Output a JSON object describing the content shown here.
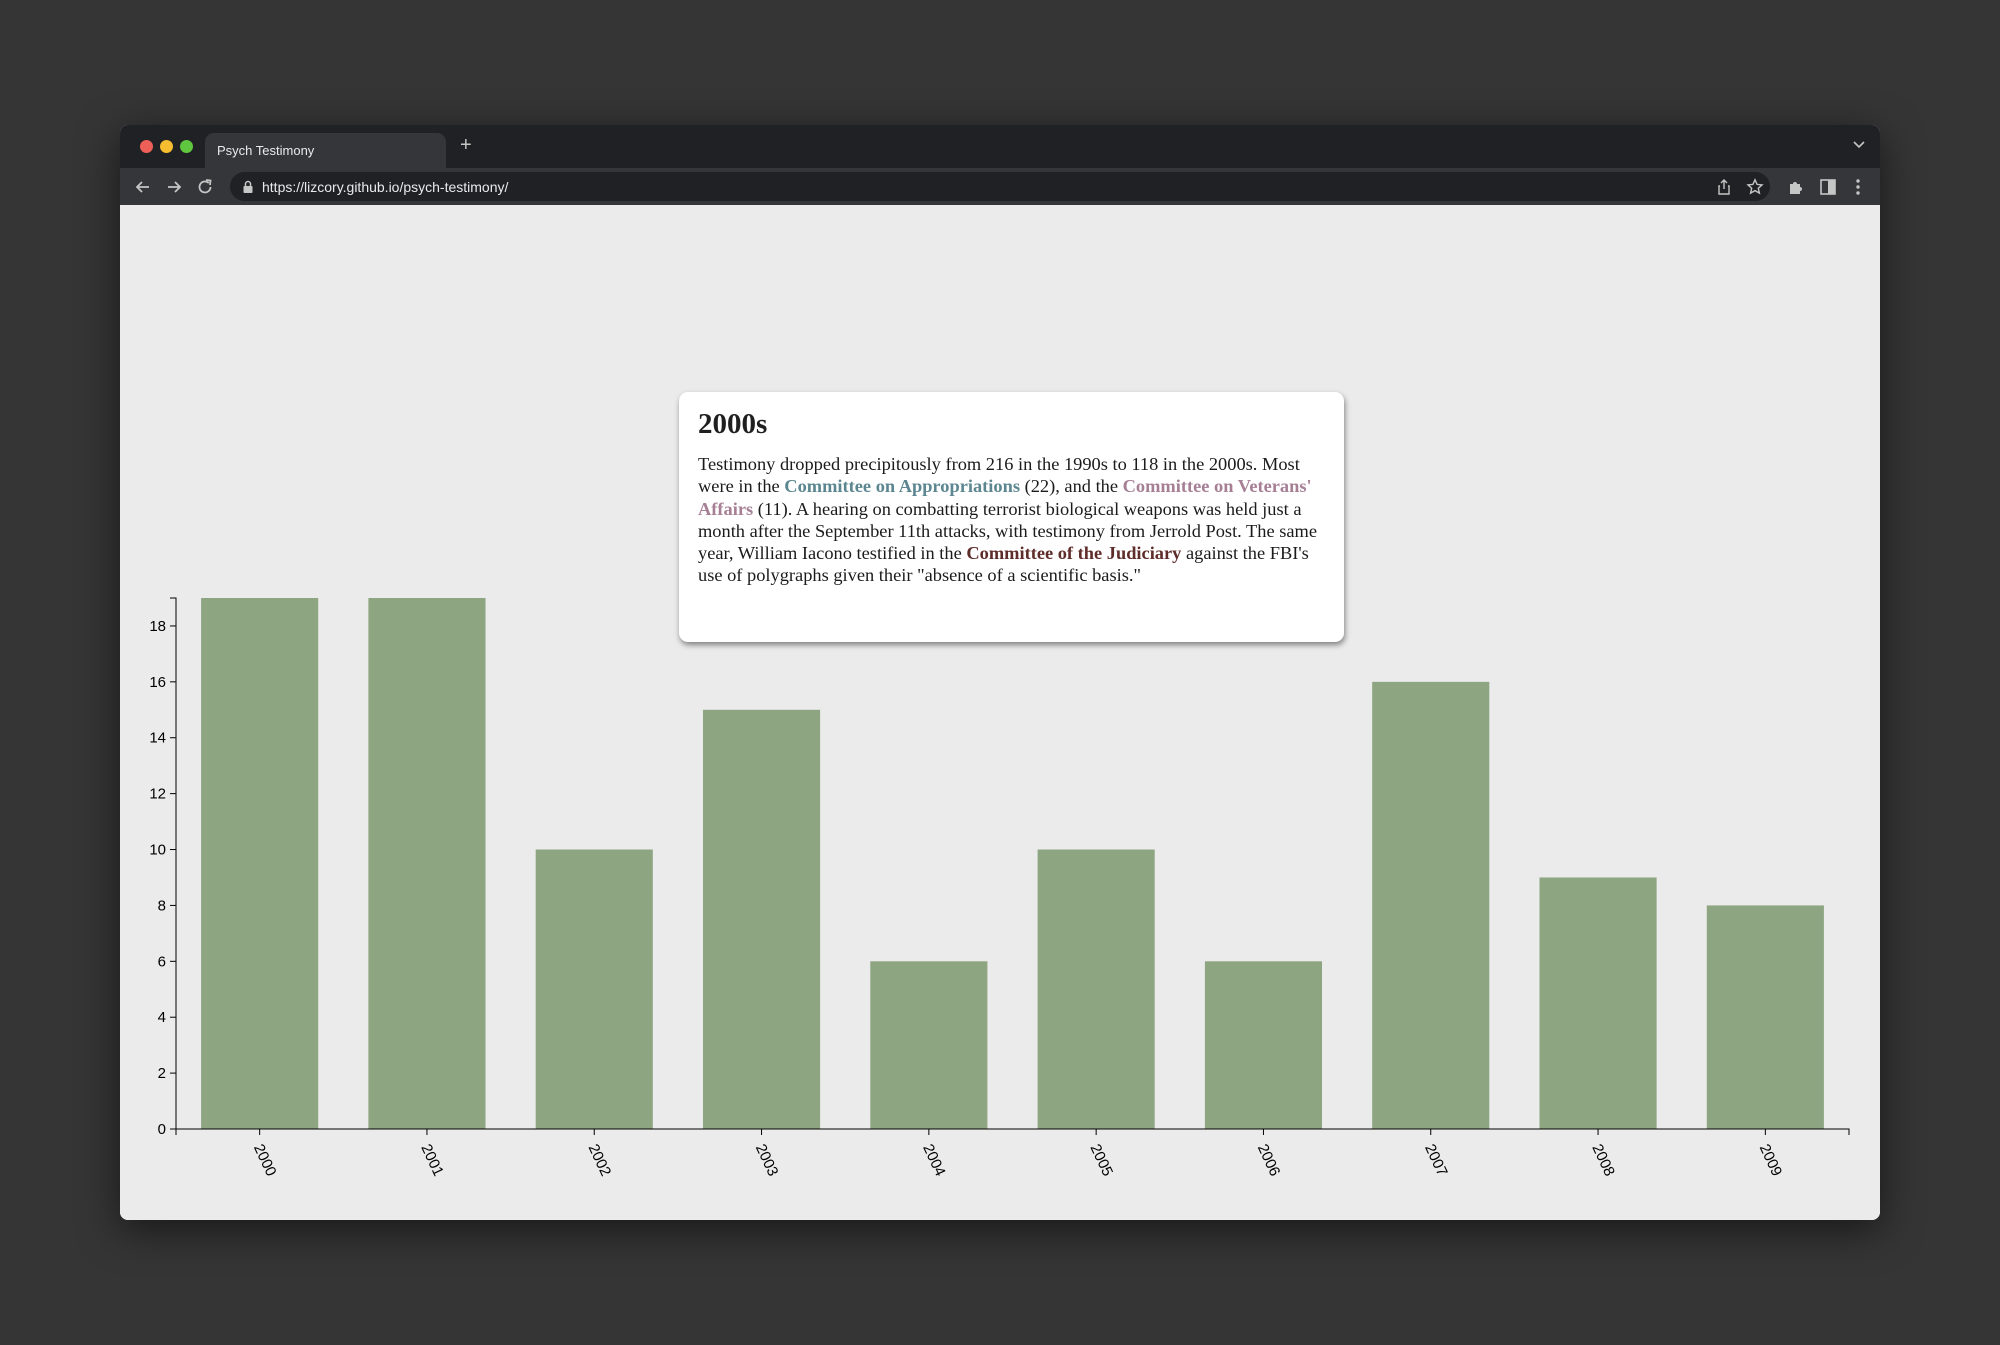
{
  "browser": {
    "tab_title": "Psych Testimony",
    "url": "https://lizcory.github.io/psych-testimony/",
    "new_tab_label": "+"
  },
  "card": {
    "heading": "2000s",
    "text_1": "Testimony dropped precipitously from 216 in the 1990s to 118 in the 2000s. Most were in the ",
    "committee_1": "Committee on Appropriations",
    "text_2": " (22), and the ",
    "committee_2": "Committee on Veterans' Affairs",
    "text_3": " (11). A hearing on combatting terrorist biological weapons was held just a month after the September 11th attacks, with testimony from Jerrold Post. The same year, William Iacono testified in the ",
    "committee_3": "Committee of the Judiciary",
    "text_4": " against the FBI's use of polygraphs given their \"absence of a scientific basis.\""
  },
  "colors": {
    "bar": "#8ea582",
    "appropriations": "#5c8790",
    "veterans": "#a67f95",
    "judiciary": "#5e2d2a"
  },
  "chart_data": {
    "type": "bar",
    "categories": [
      "2000",
      "2001",
      "2002",
      "2003",
      "2004",
      "2005",
      "2006",
      "2007",
      "2008",
      "2009"
    ],
    "values": [
      19,
      19,
      10,
      15,
      6,
      10,
      6,
      16,
      9,
      8
    ],
    "y_ticks": [
      "0",
      "2",
      "4",
      "6",
      "8",
      "10",
      "12",
      "14",
      "16",
      "18"
    ],
    "ylim": [
      0,
      19
    ],
    "grid": false,
    "title": "",
    "xlabel": "",
    "ylabel": ""
  }
}
